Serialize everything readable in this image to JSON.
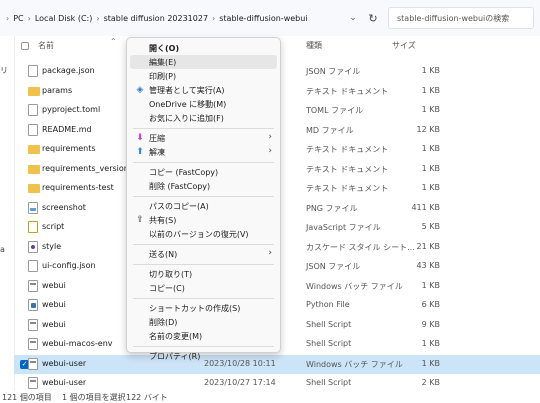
{
  "address": {
    "crumbs": [
      "PC",
      "Local Disk (C:)",
      "stable diffusion 20231027",
      "stable-diffusion-webui"
    ],
    "separator": "›",
    "dropdown": "⌄",
    "refresh": "↻",
    "search_placeholder": "stable-diffusion-webuiの検索"
  },
  "nav": {
    "labels": [
      "リ",
      "a"
    ]
  },
  "header": {
    "name": "名前",
    "type": "種類",
    "size": "サイズ"
  },
  "rows": [
    {
      "icon": "file",
      "name": "package.json",
      "date": "",
      "type": "JSON ファイル",
      "size": "1 KB"
    },
    {
      "icon": "folder",
      "name": "params",
      "date": "",
      "type": "テキスト ドキュメント",
      "size": "1 KB"
    },
    {
      "icon": "file",
      "name": "pyproject.toml",
      "date": "",
      "type": "TOML ファイル",
      "size": "1 KB"
    },
    {
      "icon": "file",
      "name": "README.md",
      "date": "",
      "type": "MD ファイル",
      "size": "12 KB"
    },
    {
      "icon": "folder",
      "name": "requirements",
      "date": "",
      "type": "テキスト ドキュメント",
      "size": "1 KB"
    },
    {
      "icon": "folder",
      "name": "requirements_versions",
      "date": "",
      "type": "テキスト ドキュメント",
      "size": "1 KB"
    },
    {
      "icon": "folder",
      "name": "requirements-test",
      "date": "",
      "type": "テキスト ドキュメント",
      "size": "1 KB"
    },
    {
      "icon": "img",
      "name": "screenshot",
      "date": "",
      "type": "PNG ファイル",
      "size": "411 KB"
    },
    {
      "icon": "js",
      "name": "script",
      "date": "",
      "type": "JavaScript ファイル",
      "size": "5 KB"
    },
    {
      "icon": "css",
      "name": "style",
      "date": "",
      "type": "カスケード スタイル シート...",
      "size": "21 KB"
    },
    {
      "icon": "file",
      "name": "ui-config.json",
      "date": "",
      "type": "JSON ファイル",
      "size": "43 KB"
    },
    {
      "icon": "bat",
      "name": "webui",
      "date": "",
      "type": "Windows バッチ ファイル",
      "size": "1 KB"
    },
    {
      "icon": "py",
      "name": "webui",
      "date": "",
      "type": "Python File",
      "size": "6 KB"
    },
    {
      "icon": "bat",
      "name": "webui",
      "date": "",
      "type": "Shell Script",
      "size": "9 KB"
    },
    {
      "icon": "bat",
      "name": "webui-macos-env",
      "date": "",
      "type": "Shell Script",
      "size": "1 KB"
    },
    {
      "icon": "bat",
      "name": "webui-user",
      "date": "2023/10/28 10:11",
      "type": "Windows バッチ ファイル",
      "size": "1 KB",
      "selected": true
    },
    {
      "icon": "bat",
      "name": "webui-user",
      "date": "2023/10/27 17:14",
      "type": "Shell Script",
      "size": "2 KB"
    }
  ],
  "menu": [
    {
      "label": "開く(O)",
      "bold": true
    },
    {
      "label": "編集(E)",
      "highlight": true
    },
    {
      "label": "印刷(P)"
    },
    {
      "label": "管理者として実行(A)",
      "icon": "shield-icon",
      "glyph": "◈",
      "color": "#2a7bd8"
    },
    {
      "label": "OneDrive に移動(M)"
    },
    {
      "label": "お気に入りに追加(F)"
    },
    {
      "sep": true
    },
    {
      "label": "圧縮",
      "icon": "zip-icon",
      "glyph": "⬇",
      "color": "#d43cc9",
      "arrow": "›"
    },
    {
      "label": "解凍",
      "icon": "extract-icon",
      "glyph": "⬆",
      "color": "#2f8bd8",
      "arrow": "›"
    },
    {
      "sep": true
    },
    {
      "label": "コピー (FastCopy)"
    },
    {
      "label": "削除 (FastCopy)"
    },
    {
      "sep": true
    },
    {
      "label": "パスのコピー(A)"
    },
    {
      "label": "共有(S)",
      "icon": "share-icon",
      "glyph": "⇪",
      "color": "#333"
    },
    {
      "label": "以前のバージョンの復元(V)"
    },
    {
      "sep": true
    },
    {
      "label": "送る(N)",
      "arrow": "›"
    },
    {
      "sep": true
    },
    {
      "label": "切り取り(T)"
    },
    {
      "label": "コピー(C)"
    },
    {
      "sep": true
    },
    {
      "label": "ショートカットの作成(S)"
    },
    {
      "label": "削除(D)"
    },
    {
      "label": "名前の変更(M)"
    },
    {
      "sep": true
    },
    {
      "label": "プロパティ(R)"
    }
  ],
  "status": {
    "items": [
      "121 個の項目",
      "1 個の項目を選択",
      "122 バイト"
    ]
  }
}
